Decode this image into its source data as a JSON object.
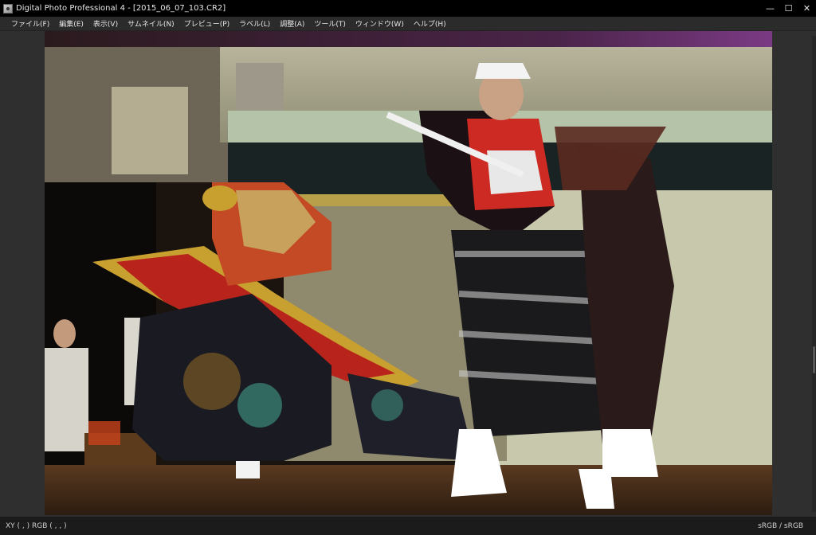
{
  "window": {
    "title": "Digital Photo Professional 4 - [2015_06_07_103.CR2]",
    "minimize_glyph": "—",
    "maximize_glyph": "☐",
    "close_glyph": "✕"
  },
  "menu": {
    "items": [
      {
        "label": "ファイル(F)"
      },
      {
        "label": "編集(E)"
      },
      {
        "label": "表示(V)"
      },
      {
        "label": "サムネイル(N)"
      },
      {
        "label": "プレビュー(P)"
      },
      {
        "label": "ラベル(L)"
      },
      {
        "label": "調整(A)"
      },
      {
        "label": "ツール(T)"
      },
      {
        "label": "ウィンドウ(W)"
      },
      {
        "label": "ヘルプ(H)"
      }
    ]
  },
  "status": {
    "xy": "XY ( , ) RGB ( , , )",
    "color_space": "sRGB / sRGB"
  },
  "colors": {
    "accent_purple": "#6b2d72",
    "background": "#2f2f2f"
  },
  "icons": [
    "app-icon",
    "minimize-icon",
    "maximize-icon",
    "close-icon"
  ]
}
